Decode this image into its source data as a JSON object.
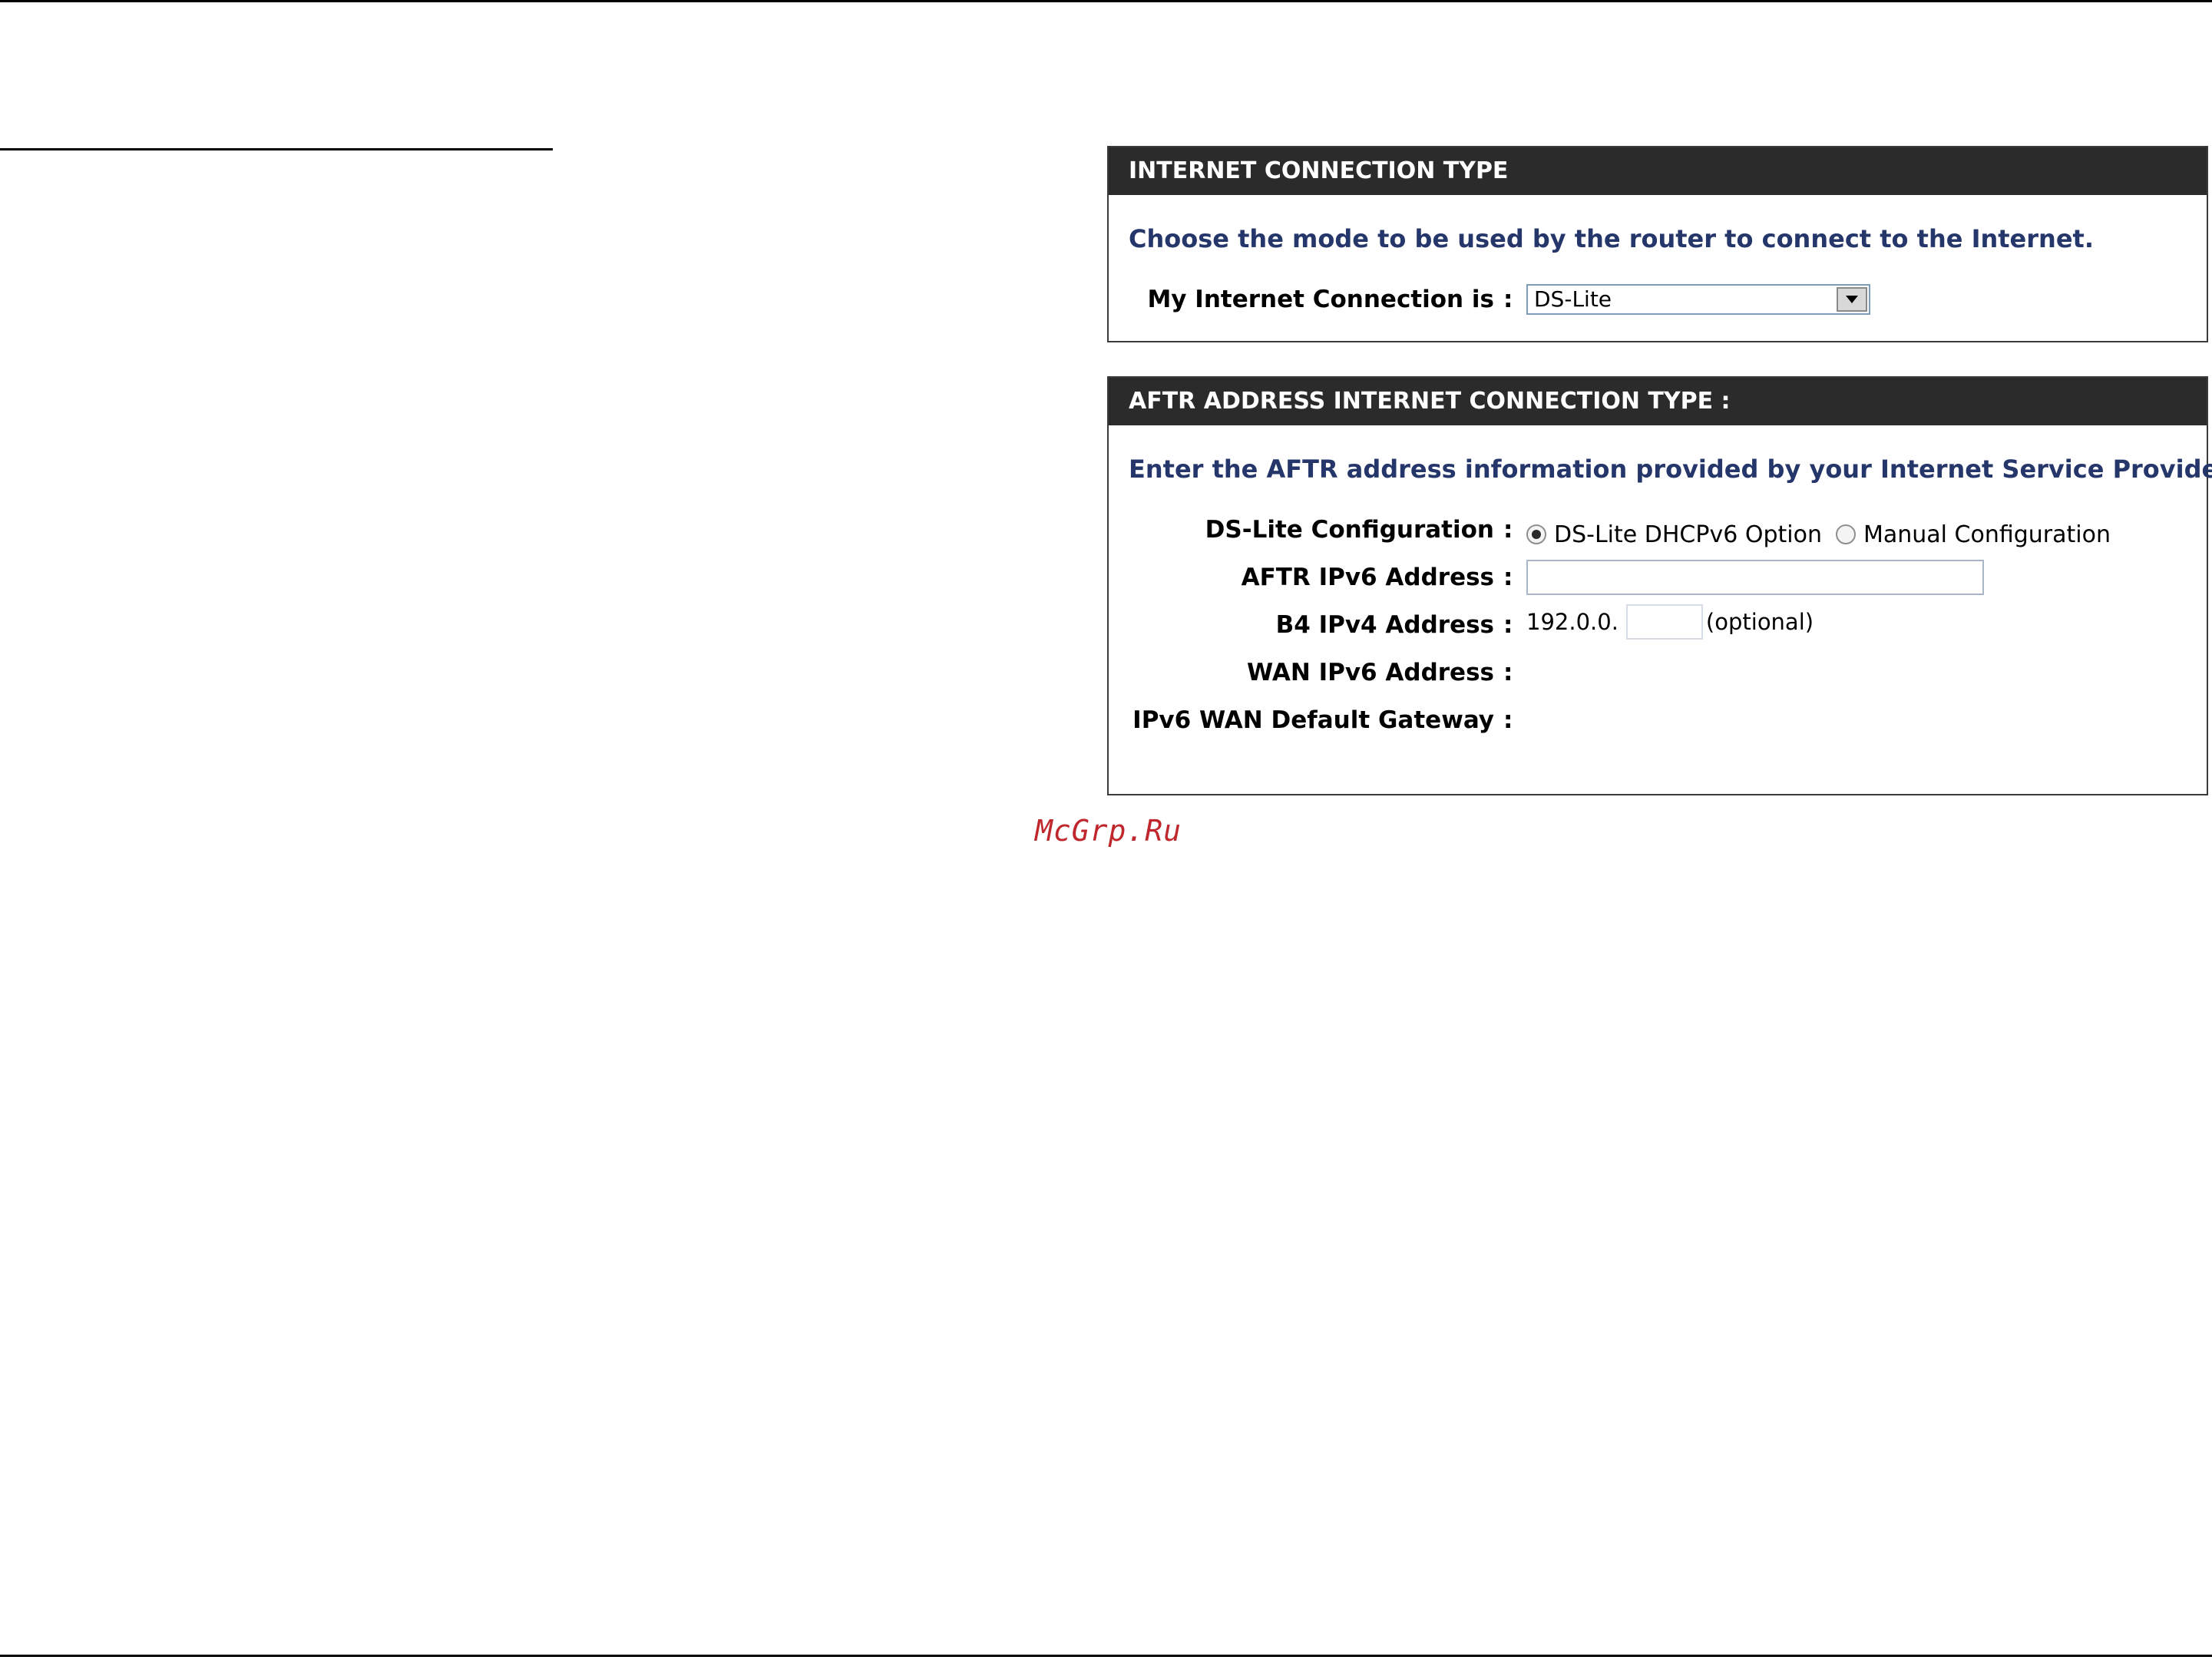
{
  "panel_connection": {
    "header": "INTERNET CONNECTION TYPE",
    "intro": "Choose the mode to be used by the router to connect to the Internet.",
    "connection_label": "My Internet Connection is",
    "connection_value": "DS-Lite"
  },
  "panel_aftr": {
    "header": "AFTR ADDRESS INTERNET CONNECTION TYPE :",
    "intro": "Enter the AFTR address information provided by your Internet Service Provider (ISP).",
    "ds_lite_label": "DS-Lite Configuration",
    "radio_dhcpv6": "DS-Lite DHCPv6 Option",
    "radio_manual": "Manual Configuration",
    "selected_option": "DS-Lite DHCPv6 Option",
    "aftr_label": "AFTR IPv6 Address",
    "aftr_value": "",
    "b4_label": "B4 IPv4 Address",
    "b4_prefix": "192.0.0.",
    "b4_value": "",
    "b4_suffix": "(optional)",
    "wan_ipv6_label": "WAN IPv6 Address",
    "gateway_label": "IPv6 WAN Default Gateway"
  },
  "colon": ":",
  "watermark": "McGrp.Ru"
}
